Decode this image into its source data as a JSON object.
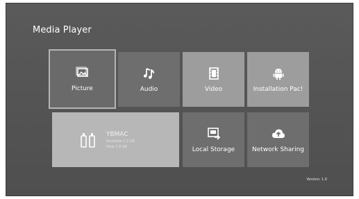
{
  "app": {
    "title": "Media Player"
  },
  "tiles": {
    "picture": {
      "label": "Picture",
      "icon": "picture-icon"
    },
    "audio": {
      "label": "Audio",
      "icon": "music-note-icon"
    },
    "video": {
      "label": "Video",
      "icon": "film-icon"
    },
    "installation": {
      "label": "Installation Pac!",
      "icon": "android-icon"
    },
    "usb": {
      "name": "YBMAC",
      "line1": "Available 2.2 GB",
      "line2": "Total 3.8 GB",
      "icon": "usb-drive-icon"
    },
    "local": {
      "label": "Local Storage",
      "icon": "local-storage-icon"
    },
    "network": {
      "label": "Network Sharing",
      "icon": "cloud-upload-icon"
    }
  },
  "footer": {
    "version": "Version: 1.0"
  }
}
